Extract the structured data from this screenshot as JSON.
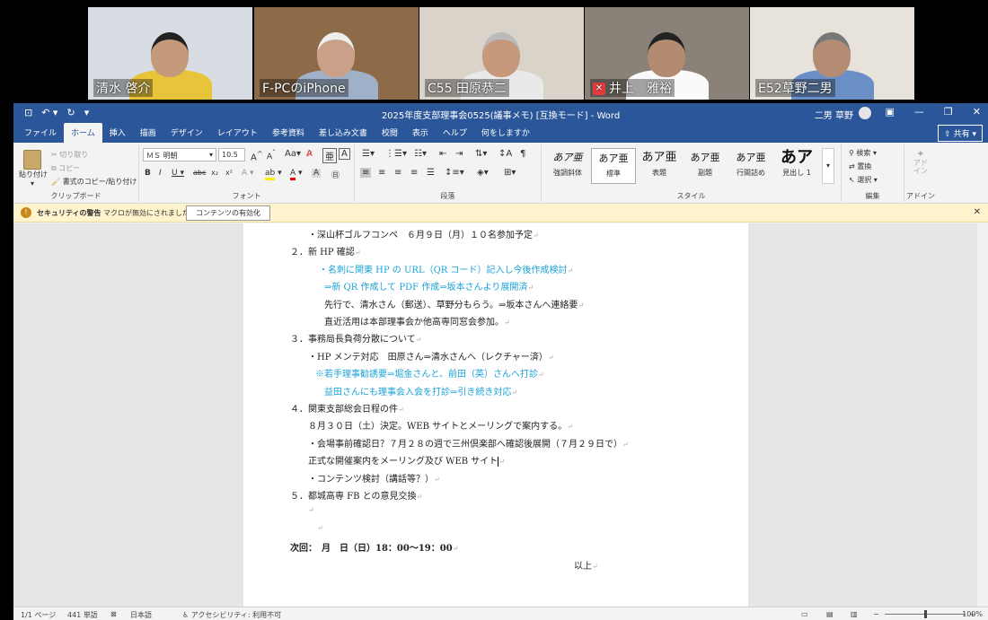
{
  "participants": [
    {
      "name": "清水 啓介",
      "muted": false,
      "active": false,
      "bg": "#d7dde3",
      "shirt": "#e8c43b",
      "skin": "#c49a7a",
      "hair": "#222"
    },
    {
      "name": "F-PCのiPhone",
      "muted": false,
      "active": false,
      "bg": "#8d6a48",
      "shirt": "#9fb1c8",
      "skin": "#caa088",
      "hair": "#eee"
    },
    {
      "name": "C55 田原恭二",
      "muted": false,
      "active": true,
      "bg": "#d9d3c9",
      "shirt": "#e9e9e9",
      "skin": "#c6987c",
      "hair": "#bbb"
    },
    {
      "name": "井上　雅裕",
      "muted": true,
      "active": false,
      "bg": "#8a8279",
      "shirt": "#fafafa",
      "skin": "#b38b70",
      "hair": "#222"
    },
    {
      "name": "E52草野二男",
      "muted": false,
      "active": false,
      "bg": "#e8e3da",
      "shirt": "#6a8fc7",
      "skin": "#b48d74",
      "hair": "#777"
    }
  ],
  "window": {
    "title": "2025年度支部理事会0525(議事メモ) [互換モード]  -  Word",
    "user": "二男 草野",
    "share": "共有"
  },
  "tabs": [
    "ファイル",
    "ホーム",
    "挿入",
    "描画",
    "デザイン",
    "レイアウト",
    "参考資料",
    "差し込み文書",
    "校閲",
    "表示",
    "ヘルプ",
    "何をしますか"
  ],
  "ribbon": {
    "paste": "貼り付け",
    "cut": "切り取り",
    "copy": "コピー",
    "format_painter": "書式のコピー/貼り付け",
    "clipboard": "クリップボード",
    "font_name": "ＭＳ 明朝",
    "font_size": "10.5",
    "font": "フォント",
    "paragraph": "段落",
    "styles": [
      {
        "sample": "あア亜",
        "label": "強調斜体"
      },
      {
        "sample": "あア亜",
        "label": "標準"
      },
      {
        "sample": "あア亜",
        "label": "表題"
      },
      {
        "sample": "あア亜",
        "label": "副題"
      },
      {
        "sample": "あア亜",
        "label": "行間詰め"
      },
      {
        "sample": "あア",
        "label": "見出し 1"
      }
    ],
    "style": "スタイル",
    "find": "検索",
    "replace": "置換",
    "select": "選択",
    "editing": "編集",
    "addins_btn": "アド\nイン",
    "addins": "アドイン"
  },
  "security": {
    "title": "セキュリティの警告",
    "message": "マクロが無効にされました。",
    "button": "コンテンツの有効化"
  },
  "document": [
    {
      "text": "・深山杯ゴルフコンペ　６月９日（月）１０名参加予定",
      "indent": 72,
      "blue": false
    },
    {
      "text": "２．新 HP 確認",
      "indent": 52,
      "blue": false
    },
    {
      "text": "・名刺に関東 HP の URL（QR コード）記入し今後作成検討",
      "indent": 84,
      "blue": true
    },
    {
      "text": "⇒新 QR 作成して PDF 作成⇒坂本さんより展開済",
      "indent": 90,
      "blue": true,
      "mixed": "⇒坂本さんより展開済"
    },
    {
      "text": "先行で、清水さん（郵送）、草野分もらう。⇒坂本さんへ連絡要",
      "indent": 90,
      "blue": false
    },
    {
      "text": "直近活用は本部理事会か他高専同窓会参加。",
      "indent": 90,
      "blue": false
    },
    {
      "text": "３．事務局長負荷分散について",
      "indent": 52,
      "blue": false
    },
    {
      "text": "・HP メンテ対応　田原さん⇒清水さんへ（レクチャー済）",
      "indent": 72,
      "blue": false
    },
    {
      "text": "※若手理事勧誘要⇒堀金さんと、前田（英）さんへ打診",
      "indent": 80,
      "blue": true
    },
    {
      "text": "益田さんにも理事会入会を打診⇒引き続き対応",
      "indent": 90,
      "blue": true,
      "mixed": "⇒引き続き対応"
    },
    {
      "text": "４．関東支部総会日程の件",
      "indent": 52,
      "blue": false
    },
    {
      "text": "８月３０日（土）決定。WEB サイトとメーリングで案内する。",
      "indent": 72,
      "blue": false
    },
    {
      "text": "・会場事前確認日？７月２８の週で三州倶楽部へ確認後展開（７月２９日で）",
      "indent": 72,
      "blue": false
    },
    {
      "text": "正式な開催案内をメーリング及び WEB サイト",
      "indent": 72,
      "blue": false,
      "cursor": true
    },
    {
      "text": "・コンテンツ検討（講話等？）",
      "indent": 72,
      "blue": false
    },
    {
      "text": "５．都城高専 FB との意見交換",
      "indent": 52,
      "blue": false
    },
    {
      "text": "",
      "indent": 72,
      "blue": false
    },
    {
      "text": "",
      "indent": 82,
      "blue": false
    },
    {
      "text": "次回：　月　日（日）18：00～19：00",
      "indent": 52,
      "blue": false,
      "bold_prefix": "次回："
    },
    {
      "text": "以上",
      "indent": 368,
      "blue": false
    }
  ],
  "status": {
    "page": "1/1 ページ",
    "words": "441 単語",
    "language": "日本語",
    "accessibility": "アクセシビリティ: 利用不可",
    "zoom": "100%",
    "zoom_level_percent": 100
  }
}
